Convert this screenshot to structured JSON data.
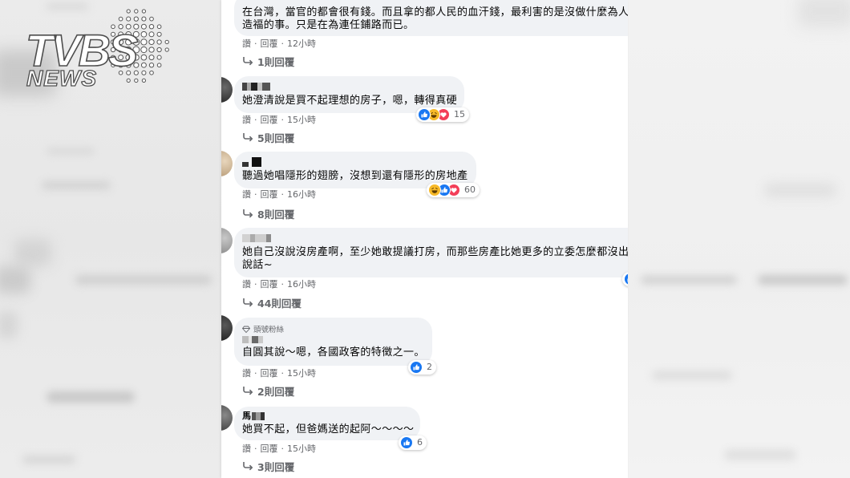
{
  "logo": {
    "brand": "TVBS",
    "sub": "NEWS"
  },
  "separator": "·",
  "colors": {
    "bubble": "#f0f2f5",
    "meta": "#65676b",
    "text": "#050505",
    "like": "#1877f2",
    "haha": "#f7b928",
    "love": "#f33e58"
  },
  "comments": [
    {
      "lines": [
        "在台灣，當官的都會很有錢。而且拿的都人民的血汗錢，最利害的是沒做什麼為人",
        "造福的事。只是在為連任鋪路而已。"
      ],
      "actions": {
        "like": "讚",
        "reply": "回覆",
        "time": "12小時"
      },
      "replies": "1則回覆"
    },
    {
      "lines": [
        "她澄清說是買不起理想的房子，嗯，轉得真硬"
      ],
      "reactions": {
        "icons": [
          "like-icon",
          "haha-icon",
          "love-icon"
        ],
        "count": "15"
      },
      "actions": {
        "like": "讚",
        "reply": "回覆",
        "time": "15小時"
      },
      "replies": "5則回覆"
    },
    {
      "lines": [
        "聽過她唱隱形的翅膀，沒想到還有隱形的房地產"
      ],
      "reactions": {
        "icons": [
          "haha-icon",
          "like-icon",
          "love-icon"
        ],
        "count": "60"
      },
      "actions": {
        "like": "讚",
        "reply": "回覆",
        "time": "16小時"
      },
      "replies": "8則回覆"
    },
    {
      "lines": [
        "她自己沒說沒房產啊，至少她敢提議打房，而那些房產比她更多的立委怎麼都沒出",
        "說話~"
      ],
      "reactions": {
        "icons": [
          "like-icon"
        ]
      },
      "actions": {
        "like": "讚",
        "reply": "回覆",
        "time": "16小時"
      },
      "replies": "44則回覆"
    },
    {
      "badge": "頭號粉絲",
      "lines": [
        "自圓其說～嗯，各國政客的特徵之一。"
      ],
      "reactions": {
        "icons": [
          "like-icon"
        ],
        "count": "2"
      },
      "actions": {
        "like": "讚",
        "reply": "回覆",
        "time": "15小時"
      },
      "replies": "2則回覆"
    },
    {
      "name": "馬",
      "lines": [
        "她買不起，但爸媽送的起阿～～～～"
      ],
      "reactions": {
        "icons": [
          "like-icon"
        ],
        "count": "6"
      },
      "actions": {
        "like": "讚",
        "reply": "回覆",
        "time": "15小時"
      },
      "replies": "3則回覆"
    }
  ]
}
